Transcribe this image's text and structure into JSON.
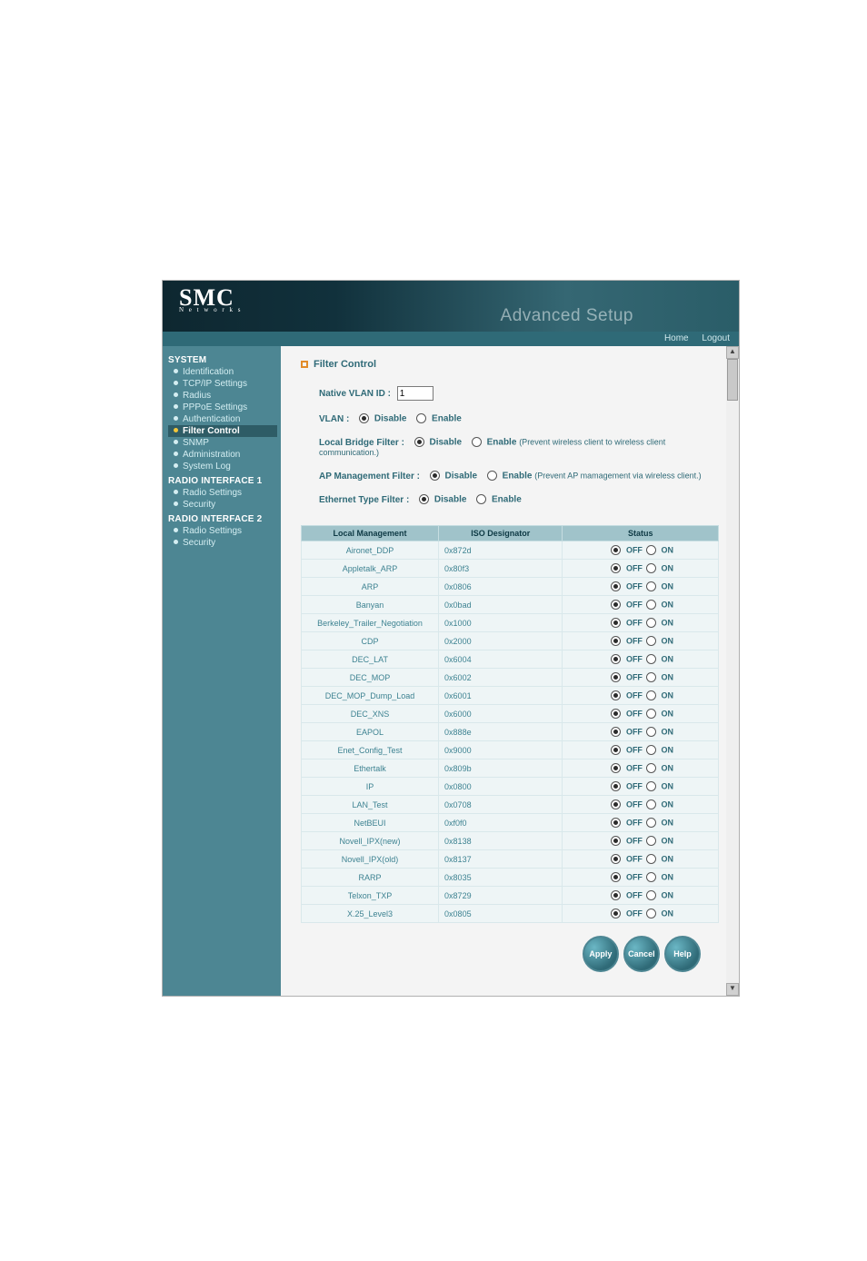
{
  "header": {
    "brand_big": "SMC",
    "brand_small": "N e t w o r k s",
    "subtitle": "Advanced Setup",
    "home": "Home",
    "logout": "Logout"
  },
  "sidebar": {
    "system_label": "SYSTEM",
    "system_items": [
      "Identification",
      "TCP/IP Settings",
      "Radius",
      "PPPoE Settings",
      "Authentication",
      "Filter Control",
      "SNMP",
      "Administration",
      "System Log"
    ],
    "active_index": 5,
    "r1_label": "RADIO INTERFACE 1",
    "r1_items": [
      "Radio Settings",
      "Security"
    ],
    "r2_label": "RADIO INTERFACE 2",
    "r2_items": [
      "Radio Settings",
      "Security"
    ]
  },
  "main": {
    "section_title": "Filter Control",
    "native_vlan_label": "Native VLAN ID  :",
    "native_vlan_value": "1",
    "vlan_label": "VLAN  :",
    "local_bridge_label": "Local Bridge Filter  :",
    "local_bridge_hint": "(Prevent wireless client to wireless client communication.)",
    "ap_mgmt_label": "AP Management Filter  :",
    "ap_mgmt_hint": "(Prevent AP mamagement via wireless client.)",
    "eth_filter_label": "Ethernet Type Filter  :",
    "disable": "Disable",
    "enable": "Enable",
    "off": "OFF",
    "on": "ON",
    "cols": {
      "c1": "Local Management",
      "c2": "ISO Designator",
      "c3": "Status"
    },
    "rows": [
      {
        "name": "Aironet_DDP",
        "iso": "0x872d"
      },
      {
        "name": "Appletalk_ARP",
        "iso": "0x80f3"
      },
      {
        "name": "ARP",
        "iso": "0x0806"
      },
      {
        "name": "Banyan",
        "iso": "0x0bad"
      },
      {
        "name": "Berkeley_Trailer_Negotiation",
        "iso": "0x1000"
      },
      {
        "name": "CDP",
        "iso": "0x2000"
      },
      {
        "name": "DEC_LAT",
        "iso": "0x6004"
      },
      {
        "name": "DEC_MOP",
        "iso": "0x6002"
      },
      {
        "name": "DEC_MOP_Dump_Load",
        "iso": "0x6001"
      },
      {
        "name": "DEC_XNS",
        "iso": "0x6000"
      },
      {
        "name": "EAPOL",
        "iso": "0x888e"
      },
      {
        "name": "Enet_Config_Test",
        "iso": "0x9000"
      },
      {
        "name": "Ethertalk",
        "iso": "0x809b"
      },
      {
        "name": "IP",
        "iso": "0x0800"
      },
      {
        "name": "LAN_Test",
        "iso": "0x0708"
      },
      {
        "name": "NetBEUI",
        "iso": "0xf0f0"
      },
      {
        "name": "Novell_IPX(new)",
        "iso": "0x8138"
      },
      {
        "name": "Novell_IPX(old)",
        "iso": "0x8137"
      },
      {
        "name": "RARP",
        "iso": "0x8035"
      },
      {
        "name": "Telxon_TXP",
        "iso": "0x8729"
      },
      {
        "name": "X.25_Level3",
        "iso": "0x0805"
      }
    ],
    "apply": "Apply",
    "cancel": "Cancel",
    "help": "Help"
  }
}
